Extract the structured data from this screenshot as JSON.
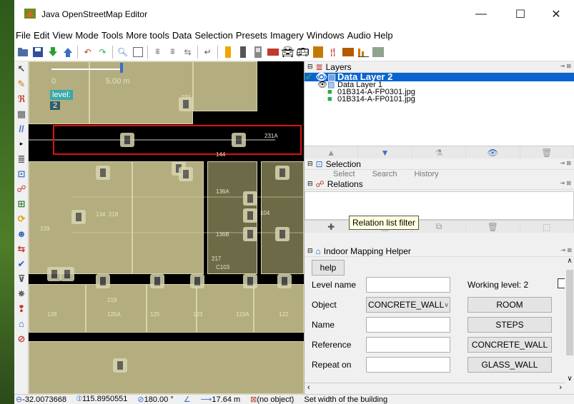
{
  "window": {
    "title": "Java OpenStreetMap Editor",
    "min": "—",
    "max": "☐",
    "close": "✕"
  },
  "menu": [
    "File",
    "Edit",
    "View",
    "Mode",
    "Tools",
    "More tools",
    "Data",
    "Selection",
    "Presets",
    "Imagery",
    "Windows",
    "Audio",
    "Help"
  ],
  "map": {
    "scale_label": "5.00 m",
    "scale_zero": "0",
    "level_label": "level:",
    "level_value": "2",
    "room_labels": [
      "231",
      "231A",
      "144",
      "136A",
      "134",
      "218",
      "129",
      "104",
      "136B",
      "217",
      "C103",
      "219",
      "125A",
      "125",
      "123",
      "123A",
      "122",
      "128"
    ],
    "selection_color": "#e01010"
  },
  "layers_panel": {
    "title": "Layers",
    "items": [
      {
        "name": "Data Layer 2",
        "active": true
      },
      {
        "name": "Data Layer 1",
        "active": false
      },
      {
        "name": "01B314-A-FP0301.jpg",
        "active": false
      },
      {
        "name": "01B314-A-FP0101.jpg",
        "active": false
      }
    ]
  },
  "selection_panel": {
    "title": "Selection",
    "select": "Select",
    "search": "Search",
    "history": "History"
  },
  "relations_panel": {
    "title": "Relations",
    "tooltip": "Relation list filter"
  },
  "indoor_panel": {
    "title": "Indoor Mapping Helper",
    "help": "help",
    "level_name_label": "Level name",
    "working_level_label": "Working level: 2",
    "object_label": "Object",
    "object_value": "CONCRETE_WALL",
    "name_label": "Name",
    "reference_label": "Reference",
    "repeat_on_label": "Repeat on",
    "buttons": [
      "ROOM",
      "STEPS",
      "CONCRETE_WALL",
      "GLASS_WALL"
    ]
  },
  "status": {
    "lat": "-32.0073668",
    "lon": "115.8950551",
    "angle": "180.00 °",
    "length": "17.64 m",
    "object": "(no object)",
    "hint": "Set width of the building"
  }
}
